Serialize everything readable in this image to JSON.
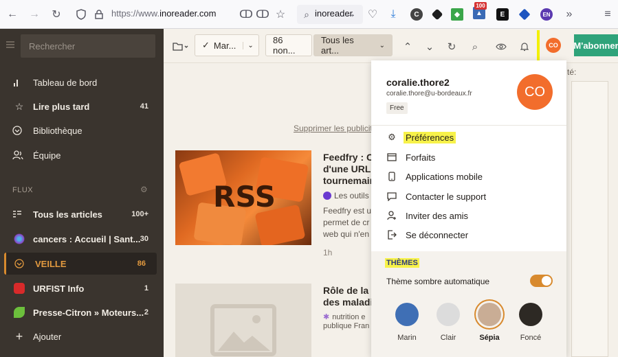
{
  "browser": {
    "url_prefix": "https://www.",
    "url_host": "inoreader.com",
    "search_text": "inoreader",
    "badge_count": "100",
    "ext_en": "EN"
  },
  "sidebar": {
    "search_placeholder": "Rechercher",
    "items": [
      {
        "label": "Tableau de bord",
        "count": ""
      },
      {
        "label": "Lire plus tard",
        "count": "41"
      },
      {
        "label": "Bibliothèque",
        "count": ""
      },
      {
        "label": "Équipe",
        "count": ""
      }
    ],
    "flux_heading": "FLUX",
    "feeds": [
      {
        "label": "Tous les articles",
        "count": "100+"
      },
      {
        "label": "cancers : Accueil | Sant...",
        "count": "30"
      },
      {
        "label": "VEILLE",
        "count": "86"
      },
      {
        "label": "URFIST Info",
        "count": "1"
      },
      {
        "label": "Presse-Citron » Moteurs...",
        "count": "2"
      },
      {
        "label": "Ajouter",
        "count": ""
      }
    ]
  },
  "toolbar": {
    "mark_label": "Mar...",
    "unread_label": "86 non...",
    "filter_label": "Tous les art...",
    "avatar_initials": "CO",
    "subscribe_label": "M'abonner"
  },
  "content": {
    "remove_ads": "Supprimer les publicite",
    "article1": {
      "title_lines": [
        "Feedfry : C",
        "d'une URL r",
        "tournemair"
      ],
      "source": "Les outils",
      "snippet_lines": [
        "Feedfry est u",
        "permet de cr",
        "web qui n'en"
      ],
      "age": "1h"
    },
    "article2": {
      "title_lines": [
        "Rôle de la r",
        "des maladi"
      ],
      "meta_lines": [
        "nutrition e",
        "publique Fran"
      ]
    },
    "right_label": "té:"
  },
  "profile_menu": {
    "username": "coralie.thore2",
    "email": "coralie.thore@u-bordeaux.fr",
    "plan": "Free",
    "avatar_initials": "CO",
    "items": [
      {
        "label": "Préférences",
        "icon": "gear-icon"
      },
      {
        "label": "Forfaits",
        "icon": "card-icon"
      },
      {
        "label": "Applications mobile",
        "icon": "phone-icon"
      },
      {
        "label": "Contacter le support",
        "icon": "chat-icon"
      },
      {
        "label": "Inviter des amis",
        "icon": "add-person-icon"
      },
      {
        "label": "Se déconnecter",
        "icon": "logout-icon"
      }
    ],
    "themes_title": "THÈMES",
    "auto_dark_label": "Thème sombre automatique",
    "auto_dark_enabled": true,
    "themes": [
      {
        "label": "Marin",
        "color": "#3f6fb5"
      },
      {
        "label": "Clair",
        "color": "#dcdcdc"
      },
      {
        "label": "Sépia",
        "color": "#c9ad95"
      },
      {
        "label": "Foncé",
        "color": "#2d2924"
      }
    ],
    "selected_theme": "Sépia"
  }
}
